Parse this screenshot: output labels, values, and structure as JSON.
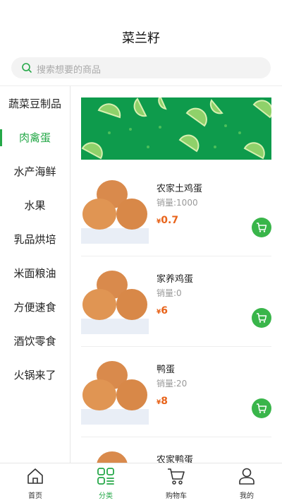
{
  "header": {
    "title": "菜兰籽"
  },
  "search": {
    "placeholder": "搜索想要的商品"
  },
  "categories": [
    "蔬菜豆制品",
    "肉禽蛋",
    "水产海鲜",
    "水果",
    "乳品烘培",
    "米面粮油",
    "方便速食",
    "酒饮零食",
    "火锅来了"
  ],
  "active_category": "肉禽蛋",
  "products": [
    {
      "name": "农家土鸡蛋",
      "sales": "销量:1000",
      "currency": "¥",
      "price": "0.7"
    },
    {
      "name": "家养鸡蛋",
      "sales": "销量:0",
      "currency": "¥",
      "price": "6"
    },
    {
      "name": "鸭蛋",
      "sales": "销量:20",
      "currency": "¥",
      "price": "8"
    },
    {
      "name": "农家鸭蛋",
      "sales": "",
      "currency": "",
      "price": ""
    }
  ],
  "tabbar": [
    {
      "label": "首页",
      "icon": "home-icon"
    },
    {
      "label": "分类",
      "icon": "category-icon"
    },
    {
      "label": "购物车",
      "icon": "cart-icon"
    },
    {
      "label": "我的",
      "icon": "user-icon"
    }
  ],
  "active_tab": "分类",
  "colors": {
    "accent": "#25a848",
    "banner": "#0e9b4c",
    "price": "#e8641b",
    "cart_button": "#39b54a"
  }
}
